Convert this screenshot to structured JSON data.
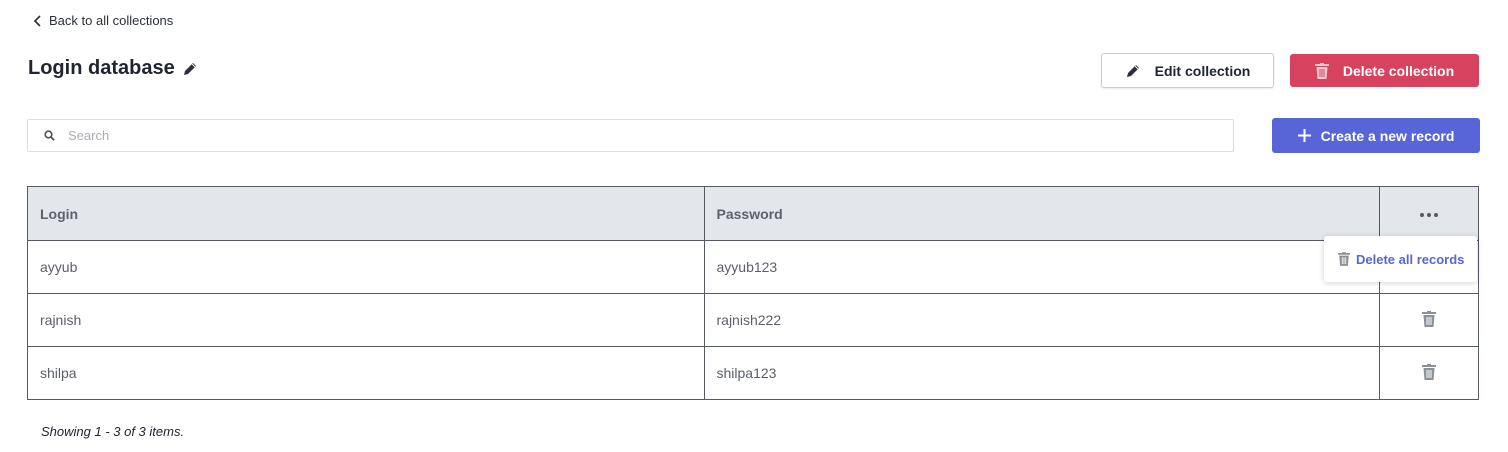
{
  "nav": {
    "back_label": "Back to all collections"
  },
  "header": {
    "title": "Login database",
    "edit_collection_label": "Edit collection",
    "delete_collection_label": "Delete collection"
  },
  "search": {
    "placeholder": "Search",
    "value": ""
  },
  "toolbar": {
    "create_record_label": "Create a new record"
  },
  "table": {
    "columns": [
      "Login",
      "Password"
    ],
    "rows": [
      {
        "login": "ayyub",
        "password": "ayyub123"
      },
      {
        "login": "rajnish",
        "password": "rajnish222"
      },
      {
        "login": "shilpa",
        "password": "shilpa123"
      }
    ]
  },
  "actions_menu": {
    "delete_all_label": "Delete all records"
  },
  "footer": {
    "status": "Showing 1 - 3 of 3 items."
  },
  "colors": {
    "danger": "#d7435e",
    "primary": "#5865d6",
    "table_header_bg": "#e3e6ea"
  },
  "icons": [
    "chevron-left-icon",
    "pencil-icon",
    "trash-icon",
    "search-icon",
    "plus-icon",
    "more-horizontal-icon"
  ]
}
